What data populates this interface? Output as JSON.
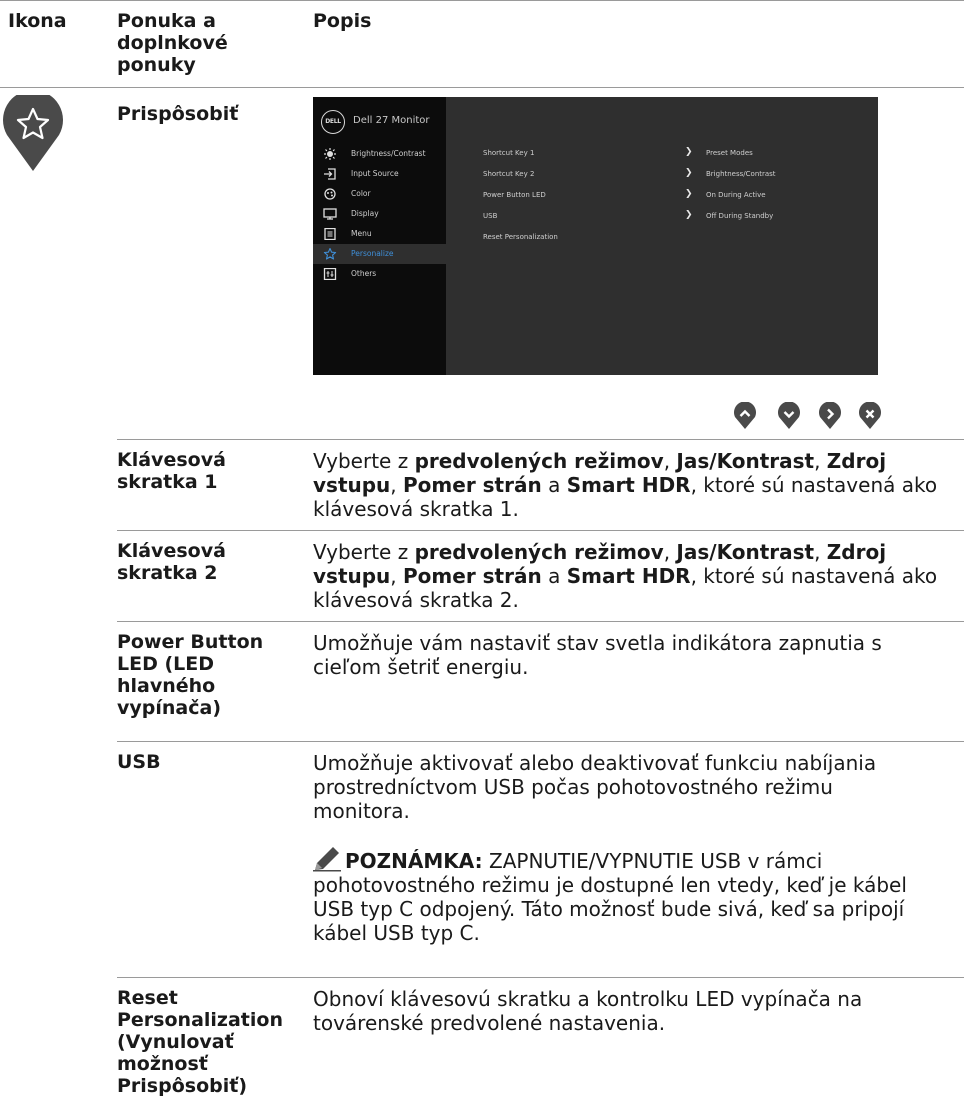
{
  "header": {
    "col_icon": "Ikona",
    "col_menu": "Ponuka a doplnkové ponuky",
    "col_desc": "Popis"
  },
  "section": {
    "title": "Prispôsobiť",
    "icon": "star-icon"
  },
  "osd": {
    "logo": "DELL",
    "title": "Dell 27 Monitor",
    "menu": [
      {
        "label": "Brightness/Contrast",
        "icon": "brightness-icon"
      },
      {
        "label": "Input Source",
        "icon": "input-source-icon"
      },
      {
        "label": "Color",
        "icon": "color-icon"
      },
      {
        "label": "Display",
        "icon": "display-icon"
      },
      {
        "label": "Menu",
        "icon": "menu-icon"
      },
      {
        "label": "Personalize",
        "icon": "star-icon",
        "selected": true
      },
      {
        "label": "Others",
        "icon": "others-icon"
      }
    ],
    "submenu": [
      {
        "label": "Shortcut Key 1",
        "value": "Preset Modes"
      },
      {
        "label": "Shortcut Key 2",
        "value": "Brightness/Contrast"
      },
      {
        "label": "Power Button LED",
        "value": "On During Active"
      },
      {
        "label": "USB",
        "value": "Off During Standby"
      },
      {
        "label": "Reset Personalization",
        "value": ""
      }
    ],
    "highlight_color": "#3f8fd8"
  },
  "nav_buttons": [
    "up-icon",
    "down-icon",
    "right-icon",
    "close-icon"
  ],
  "rows": {
    "shortcut1": {
      "label": "Klávesová skratka 1",
      "d1": "Vyberte z ",
      "b1": "predvolených režimov",
      "d2": ", ",
      "b2": "Jas/Kontrast",
      "d3": ", ",
      "b3": "Zdroj vstupu",
      "d4": ", ",
      "b4": "Pomer strán",
      "d5": " a ",
      "b5": "Smart HDR",
      "d6": ", ktoré sú nastavená ako klávesová skratka 1."
    },
    "shortcut2": {
      "label": "Klávesová skratka 2",
      "d1": "Vyberte z ",
      "b1": "predvolených režimov",
      "d2": ", ",
      "b2": "Jas/Kontrast",
      "d3": ", ",
      "b3": "Zdroj vstupu",
      "d4": ", ",
      "b4": "Pomer strán",
      "d5": " a ",
      "b5": "Smart HDR",
      "d6": ", ktoré sú nastavená ako klávesová skratka 2."
    },
    "power_led": {
      "label": "Power Button LED (LED hlavného vypínača)",
      "desc": "Umožňuje vám nastaviť stav svetla indikátora zapnutia s cieľom šetriť energiu."
    },
    "usb": {
      "label": "USB",
      "desc": "Umožňuje aktivovať alebo deaktivovať funkciu nabíjania prostredníctvom USB počas pohotovostného režimu monitora.",
      "note_label": "POZNÁMKA:",
      "note_text": " ZAPNUTIE/VYPNUTIE USB v rámci pohotovostného režimu je dostupné len vtedy, keď je kábel USB typ C odpojený. Táto možnosť bude sivá, keď sa pripojí kábel USB typ C."
    },
    "reset": {
      "label": "Reset Personalization (Vynulovať možnosť Prispôsobiť)",
      "desc": "Obnoví klávesovú skratku a kontrolku LED vypínača na továrenské predvolené nastavenia."
    }
  }
}
